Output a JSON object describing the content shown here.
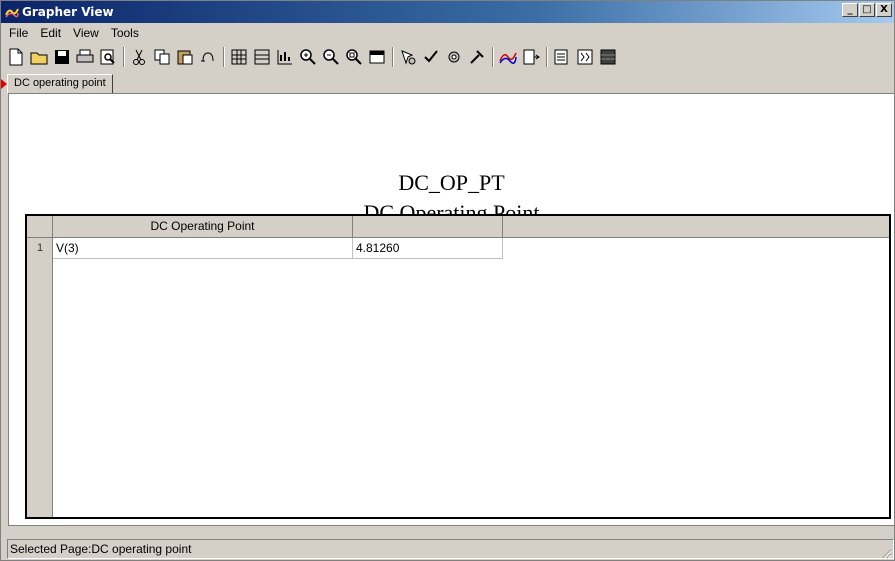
{
  "window": {
    "title": "Grapher View",
    "minimize": "_",
    "maximize": "□",
    "close": "X"
  },
  "menu": [
    "File",
    "Edit",
    "View",
    "Tools"
  ],
  "toolbar": [
    "new-icon",
    "open-icon",
    "save-icon",
    "print-icon",
    "print-preview-icon",
    "sep",
    "cut-icon",
    "copy-icon",
    "paste-icon",
    "undo-icon",
    "sep",
    "grid-icon",
    "list-icon",
    "chart-icon",
    "zoom-in-icon",
    "zoom-out-icon",
    "zoom-area-icon",
    "window-icon",
    "sep",
    "cursor-icon",
    "cursor-check-icon",
    "cursor-gear-icon",
    "cursor-tools-icon",
    "sep",
    "graph-icon",
    "export-icon",
    "sep",
    "transfer-icon",
    "table-icon",
    "overlay-icon"
  ],
  "tab": {
    "label": "DC operating point"
  },
  "page": {
    "title": "DC_OP_PT",
    "subtitle": "DC Operating Point"
  },
  "grid": {
    "columns": [
      "DC Operating Point",
      ""
    ],
    "rows": [
      {
        "num": "1",
        "cells": [
          "V(3)",
          "4.81260"
        ]
      }
    ]
  },
  "status": {
    "text": "Selected Page:DC operating point"
  },
  "colors": {
    "title_bar": "#0a246a",
    "face": "#d4d0c8",
    "tab_marker": "#e00000"
  }
}
